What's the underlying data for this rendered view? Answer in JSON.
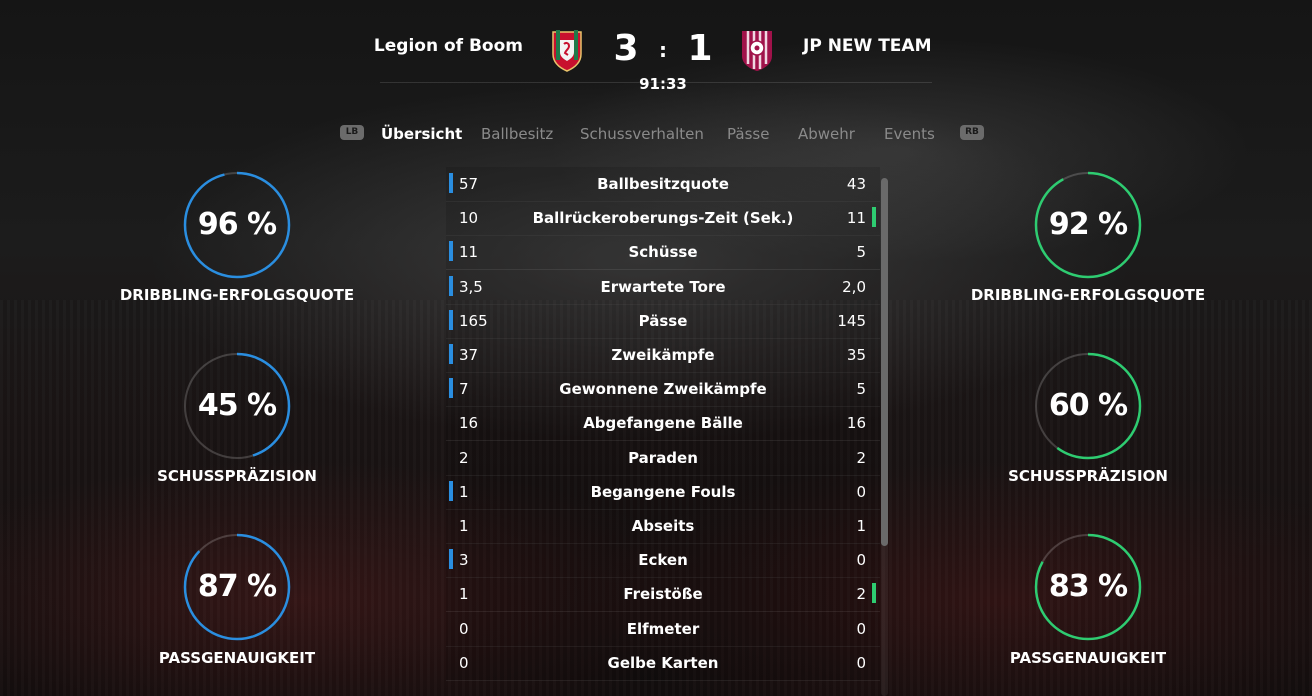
{
  "scoreboard": {
    "home_team": "Legion of Boom",
    "away_team": "JP NEW TEAM",
    "home_score": "3",
    "separator": ":",
    "away_score": "1",
    "clock": "91:33"
  },
  "tabs": {
    "lb": "LB",
    "rb": "RB",
    "items": [
      {
        "label": "Übersicht",
        "active": true
      },
      {
        "label": "Ballbesitz",
        "active": false
      },
      {
        "label": "Schussverhalten",
        "active": false
      },
      {
        "label": "Pässe",
        "active": false
      },
      {
        "label": "Abwehr",
        "active": false
      },
      {
        "label": "Events",
        "active": false
      }
    ]
  },
  "colors": {
    "home_accent": "#2a8ee0",
    "away_accent": "#2ecc71",
    "home_crest": "#c8102e",
    "away_crest": "#a0124a"
  },
  "rings": {
    "home": [
      {
        "value": "96 %",
        "fraction": 0.96,
        "label": "DRIBBLING-ERFOLGSQUOTE"
      },
      {
        "value": "45 %",
        "fraction": 0.45,
        "label": "SCHUSSPRÄZISION"
      },
      {
        "value": "87 %",
        "fraction": 0.87,
        "label": "PASSGENAUIGKEIT"
      }
    ],
    "away": [
      {
        "value": "92 %",
        "fraction": 0.92,
        "label": "DRIBBLING-ERFOLGSQUOTE"
      },
      {
        "value": "60 %",
        "fraction": 0.6,
        "label": "SCHUSSPRÄZISION"
      },
      {
        "value": "83 %",
        "fraction": 0.83,
        "label": "PASSGENAUIGKEIT"
      }
    ]
  },
  "stats": [
    {
      "label": "Ballbesitzquote",
      "home": "57",
      "away": "43",
      "leader": "home"
    },
    {
      "label": "Ballrückeroberungs-Zeit (Sek.)",
      "home": "10",
      "away": "11",
      "leader": "away"
    },
    {
      "label": "Schüsse",
      "home": "11",
      "away": "5",
      "leader": "home"
    },
    {
      "label": "Erwartete Tore",
      "home": "3,5",
      "away": "2,0",
      "leader": "home"
    },
    {
      "label": "Pässe",
      "home": "165",
      "away": "145",
      "leader": "home"
    },
    {
      "label": "Zweikämpfe",
      "home": "37",
      "away": "35",
      "leader": "home"
    },
    {
      "label": "Gewonnene Zweikämpfe",
      "home": "7",
      "away": "5",
      "leader": "home"
    },
    {
      "label": "Abgefangene Bälle",
      "home": "16",
      "away": "16",
      "leader": "none"
    },
    {
      "label": "Paraden",
      "home": "2",
      "away": "2",
      "leader": "none"
    },
    {
      "label": "Begangene Fouls",
      "home": "1",
      "away": "0",
      "leader": "home"
    },
    {
      "label": "Abseits",
      "home": "1",
      "away": "1",
      "leader": "none"
    },
    {
      "label": "Ecken",
      "home": "3",
      "away": "0",
      "leader": "home"
    },
    {
      "label": "Freistöße",
      "home": "1",
      "away": "2",
      "leader": "away"
    },
    {
      "label": "Elfmeter",
      "home": "0",
      "away": "0",
      "leader": "none"
    },
    {
      "label": "Gelbe Karten",
      "home": "0",
      "away": "0",
      "leader": "none"
    }
  ]
}
